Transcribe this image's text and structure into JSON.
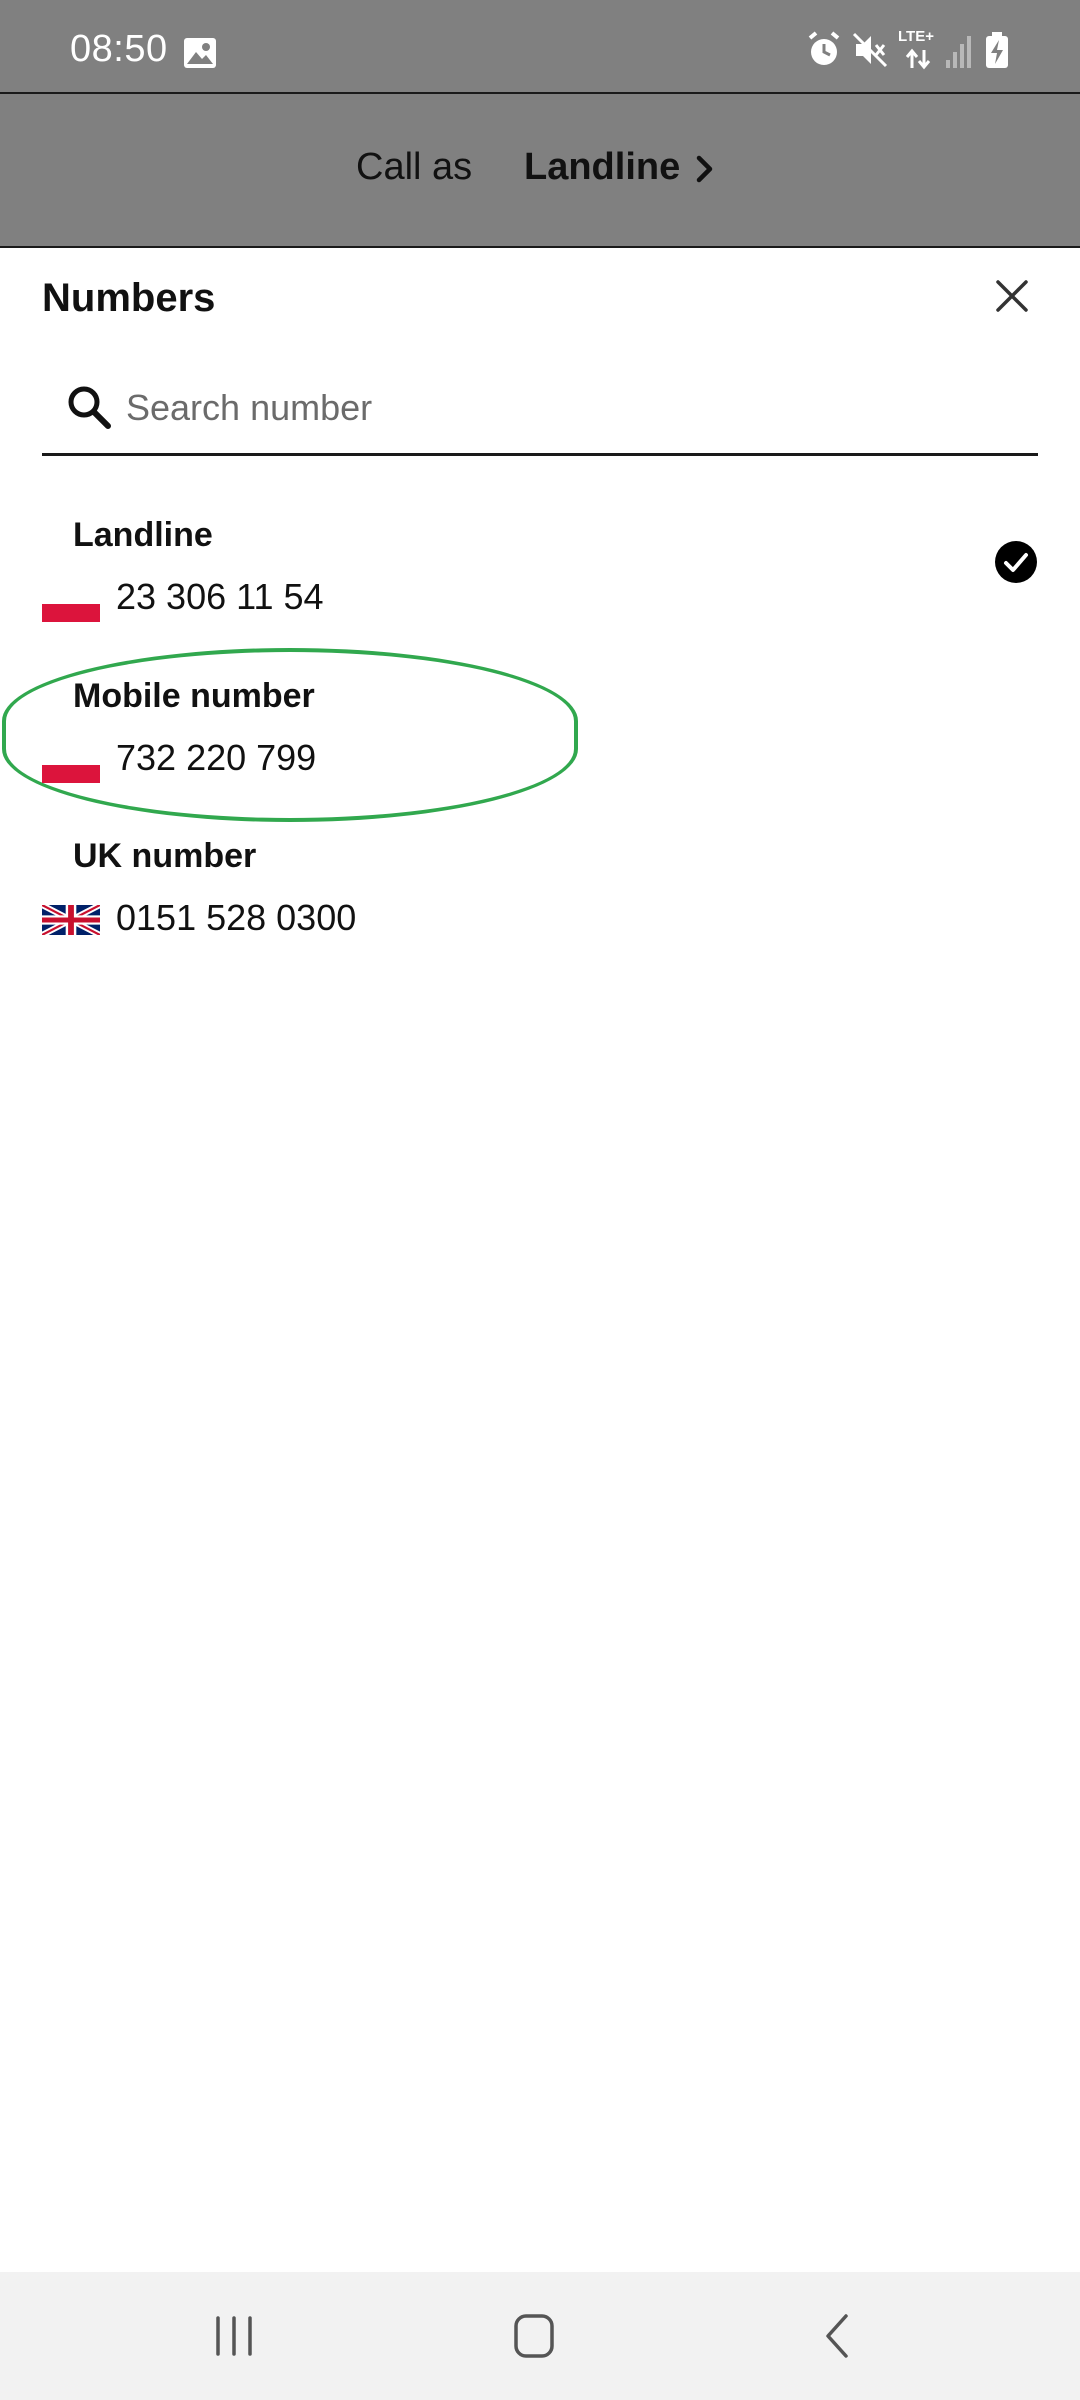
{
  "status_bar": {
    "time": "08:50",
    "icons": [
      "gallery-icon",
      "alarm-icon",
      "mute-icon",
      "lte-icon",
      "signal-icon",
      "battery-charging-icon"
    ],
    "lte_label": "LTE+"
  },
  "call_as": {
    "label": "Call as",
    "value": "Landline"
  },
  "sheet": {
    "title": "Numbers",
    "search_placeholder": "Search number",
    "search_value": ""
  },
  "numbers": [
    {
      "name": "Landline",
      "number": "23 306 11 54",
      "flag": "PL",
      "selected": true
    },
    {
      "name": "Mobile number",
      "number": "732 220 799",
      "flag": "PL",
      "selected": false
    },
    {
      "name": "UK number",
      "number": "0151 528 0300",
      "flag": "UK",
      "selected": false
    }
  ],
  "colors": {
    "header_bg": "#808080",
    "highlight": "#31a84e",
    "poland_red": "#dc143c"
  }
}
